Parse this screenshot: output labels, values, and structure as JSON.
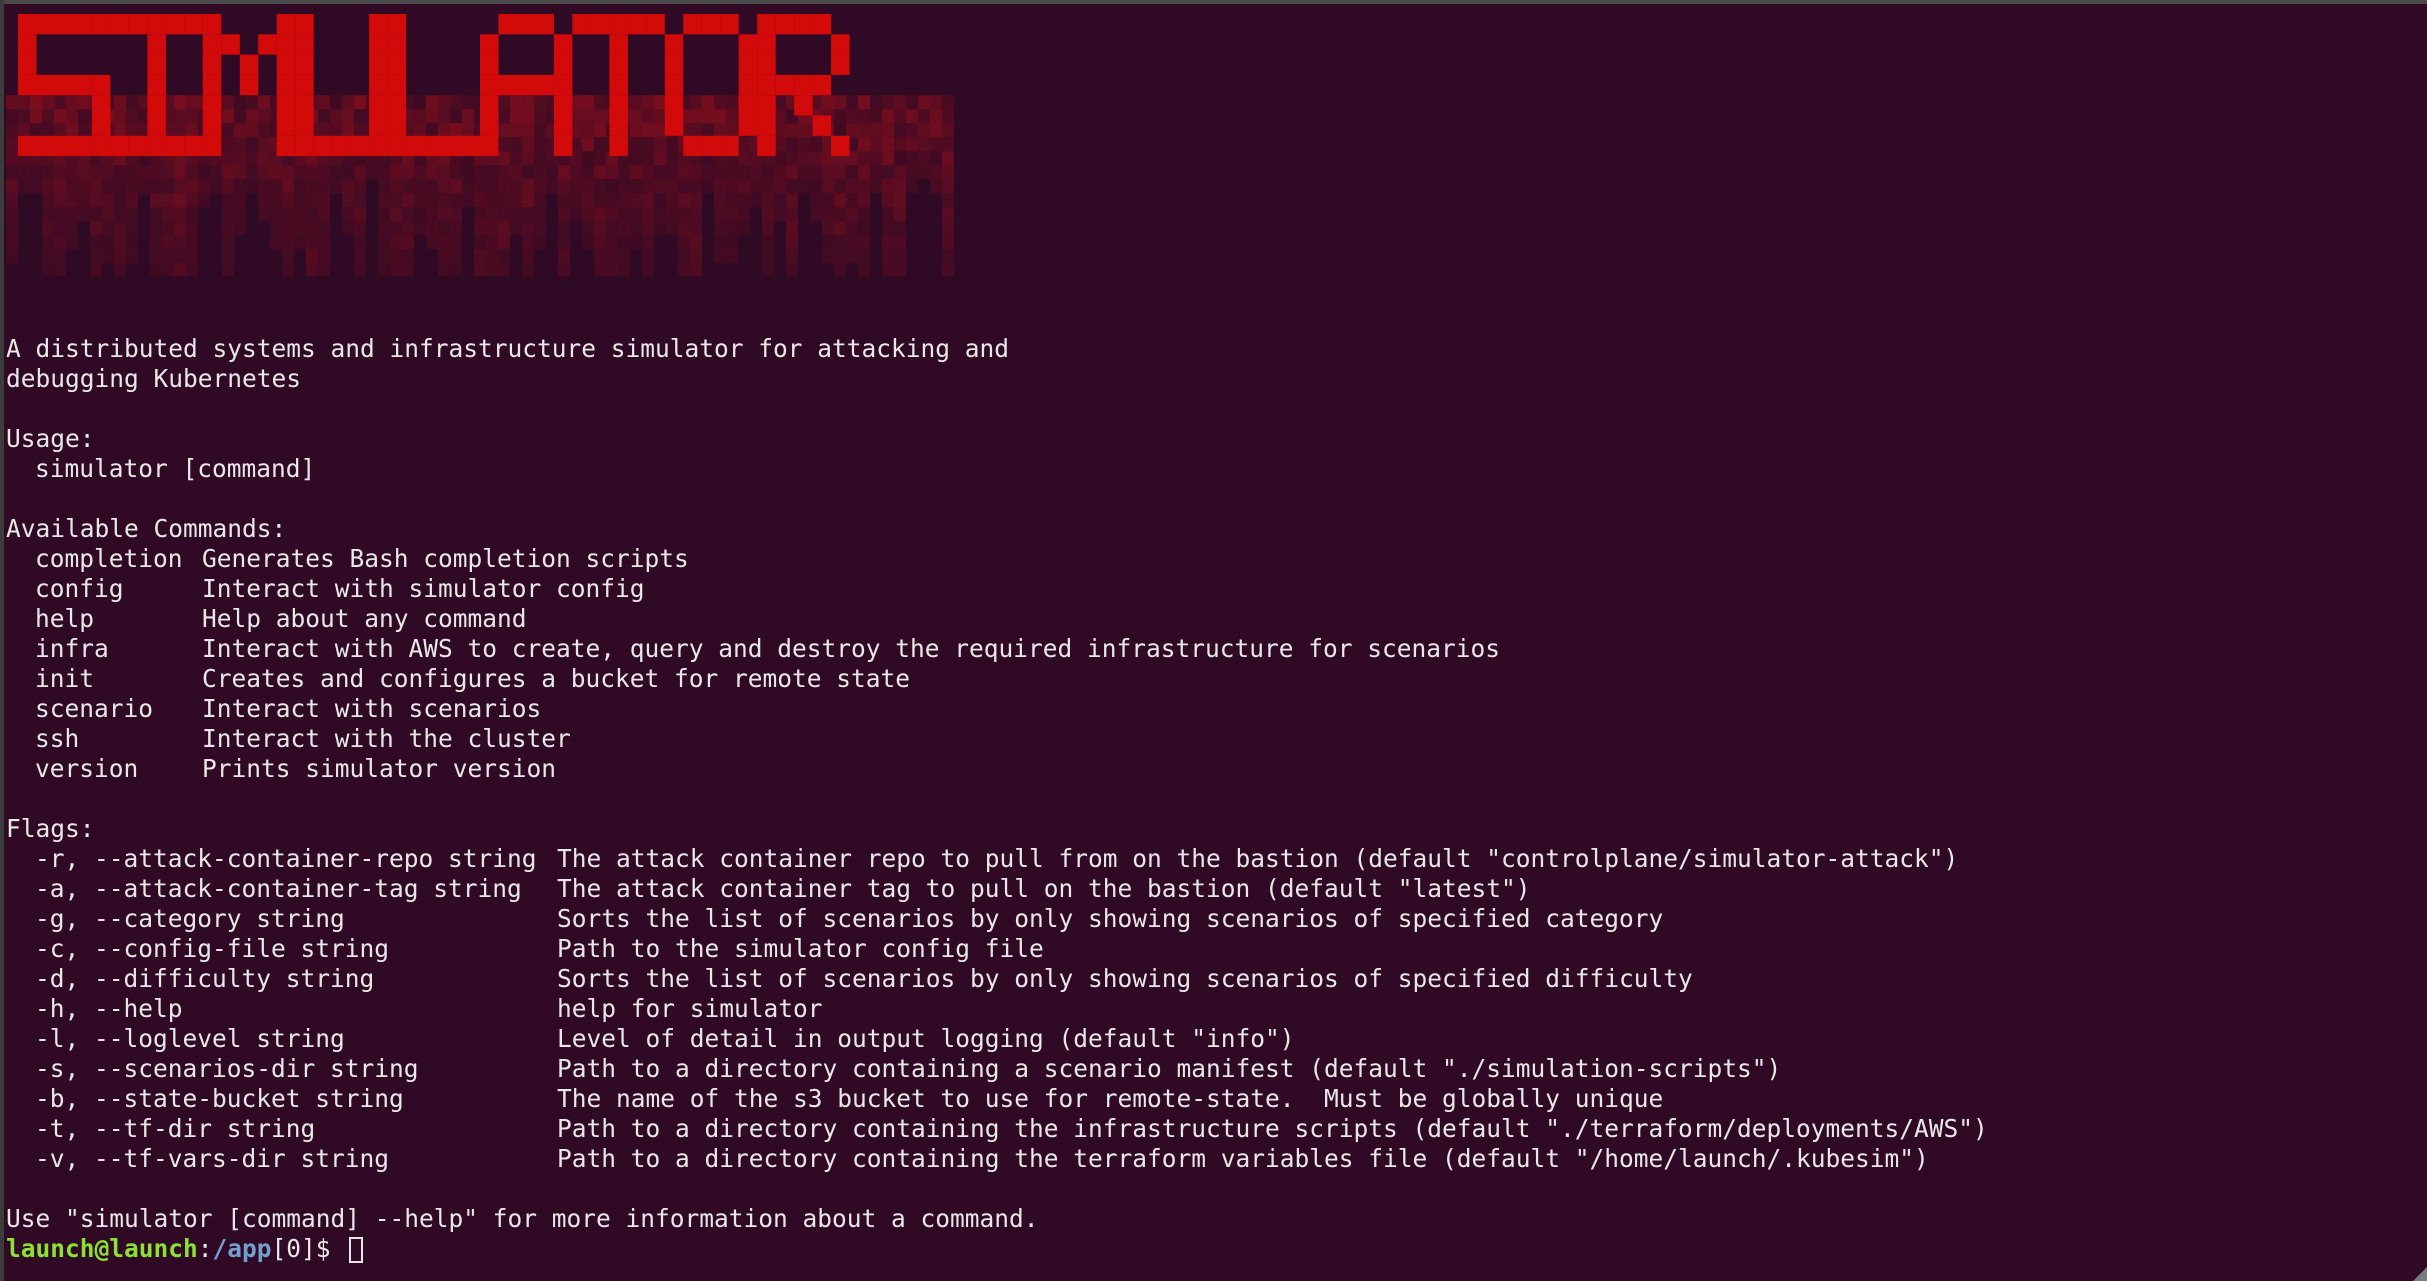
{
  "window": {
    "background": "#300a24",
    "accent_red": "#d20a0a",
    "prompt_green": "#8ae234",
    "prompt_blue": "#729fcf"
  },
  "banner": {
    "logo_text": "SIMULATOR"
  },
  "description": [
    "A distributed systems and infrastructure simulator for attacking and",
    "debugging Kubernetes"
  ],
  "usage": {
    "heading": "Usage:",
    "command": "simulator [command]"
  },
  "commands": {
    "heading": "Available Commands:",
    "items": [
      {
        "name": "completion",
        "desc": "Generates Bash completion scripts"
      },
      {
        "name": "config",
        "desc": "Interact with simulator config"
      },
      {
        "name": "help",
        "desc": "Help about any command"
      },
      {
        "name": "infra",
        "desc": "Interact with AWS to create, query and destroy the required infrastructure for scenarios"
      },
      {
        "name": "init",
        "desc": "Creates and configures a bucket for remote state"
      },
      {
        "name": "scenario",
        "desc": "Interact with scenarios"
      },
      {
        "name": "ssh",
        "desc": "Interact with the cluster"
      },
      {
        "name": "version",
        "desc": "Prints simulator version"
      }
    ]
  },
  "flags": {
    "heading": "Flags:",
    "items": [
      {
        "name": "-r, --attack-container-repo string",
        "desc": "The attack container repo to pull from on the bastion (default \"controlplane/simulator-attack\")"
      },
      {
        "name": "-a, --attack-container-tag string",
        "desc": "The attack container tag to pull on the bastion (default \"latest\")"
      },
      {
        "name": "-g, --category string",
        "desc": "Sorts the list of scenarios by only showing scenarios of specified category"
      },
      {
        "name": "-c, --config-file string",
        "desc": "Path to the simulator config file"
      },
      {
        "name": "-d, --difficulty string",
        "desc": "Sorts the list of scenarios by only showing scenarios of specified difficulty"
      },
      {
        "name": "-h, --help",
        "desc": "help for simulator"
      },
      {
        "name": "-l, --loglevel string",
        "desc": "Level of detail in output logging (default \"info\")"
      },
      {
        "name": "-s, --scenarios-dir string",
        "desc": "Path to a directory containing a scenario manifest (default \"./simulation-scripts\")"
      },
      {
        "name": "-b, --state-bucket string",
        "desc": "The name of the s3 bucket to use for remote-state.  Must be globally unique"
      },
      {
        "name": "-t, --tf-dir string",
        "desc": "Path to a directory containing the infrastructure scripts (default \"./terraform/deployments/AWS\")"
      },
      {
        "name": "-v, --tf-vars-dir string",
        "desc": "Path to a directory containing the terraform variables file (default \"/home/launch/.kubesim\")"
      }
    ]
  },
  "footer": "Use \"simulator [command] --help\" for more information about a command.",
  "prompt": {
    "user_host": "launch@launch",
    "sep": ":",
    "path": "/app",
    "suffix": "[0]$ "
  }
}
